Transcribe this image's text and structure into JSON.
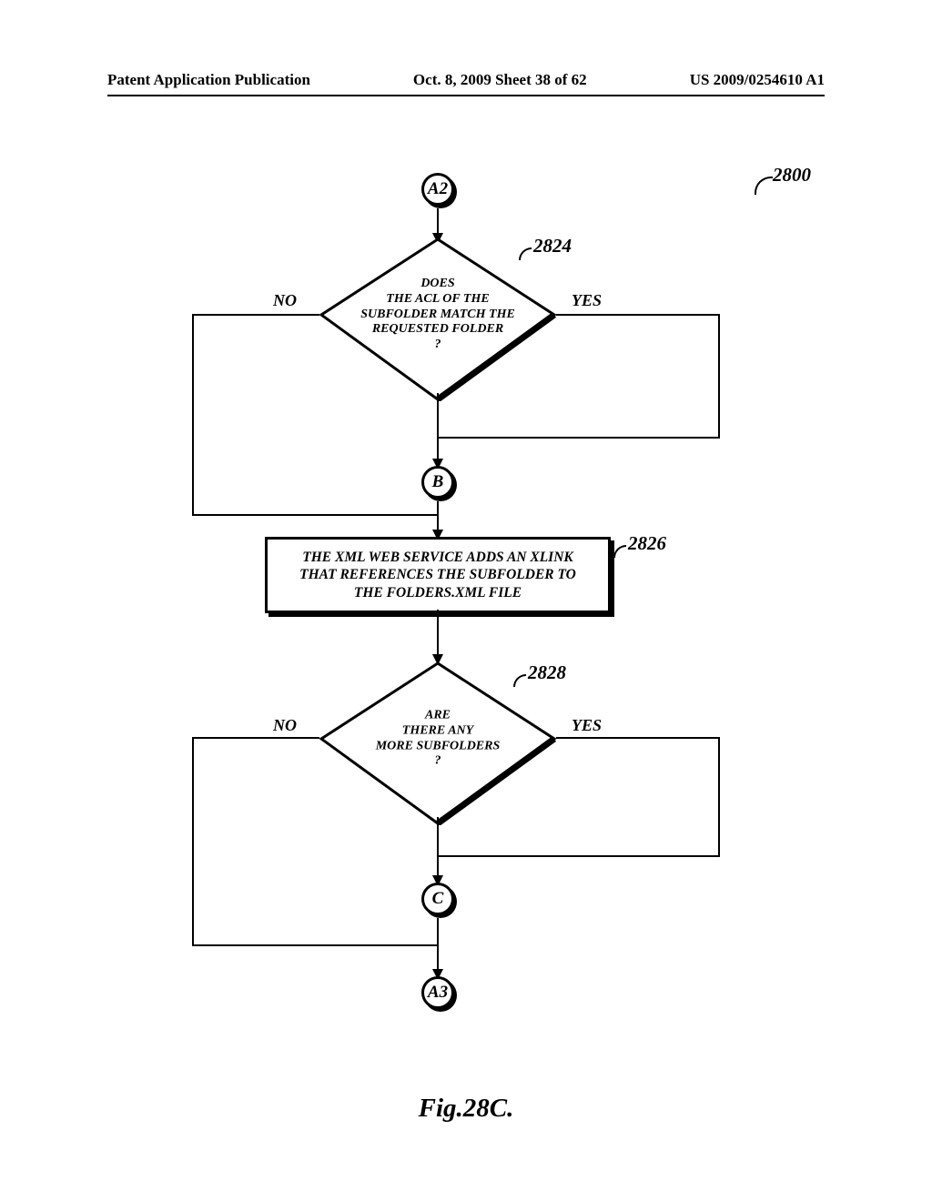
{
  "header": {
    "left": "Patent Application Publication",
    "center": "Oct. 8, 2009  Sheet 38 of 62",
    "right": "US 2009/0254610 A1"
  },
  "flowchart_ref": "2800",
  "connectors": {
    "a2": "A2",
    "b": "B",
    "c": "C",
    "a3": "A3"
  },
  "decisions": {
    "d1": {
      "text": "DOES\nTHE ACL OF THE\nSUBFOLDER MATCH THE\nREQUESTED FOLDER\n?",
      "ref": "2824",
      "no": "NO",
      "yes": "YES"
    },
    "d2": {
      "text": "ARE\nTHERE ANY\nMORE SUBFOLDERS\n?",
      "ref": "2828",
      "no": "NO",
      "yes": "YES"
    }
  },
  "processes": {
    "p1": {
      "text": "THE XML WEB SERVICE ADDS AN XLINK THAT REFERENCES THE SUBFOLDER TO THE FOLDERS.XML FILE",
      "ref": "2826"
    }
  },
  "figure": "Fig.28C."
}
